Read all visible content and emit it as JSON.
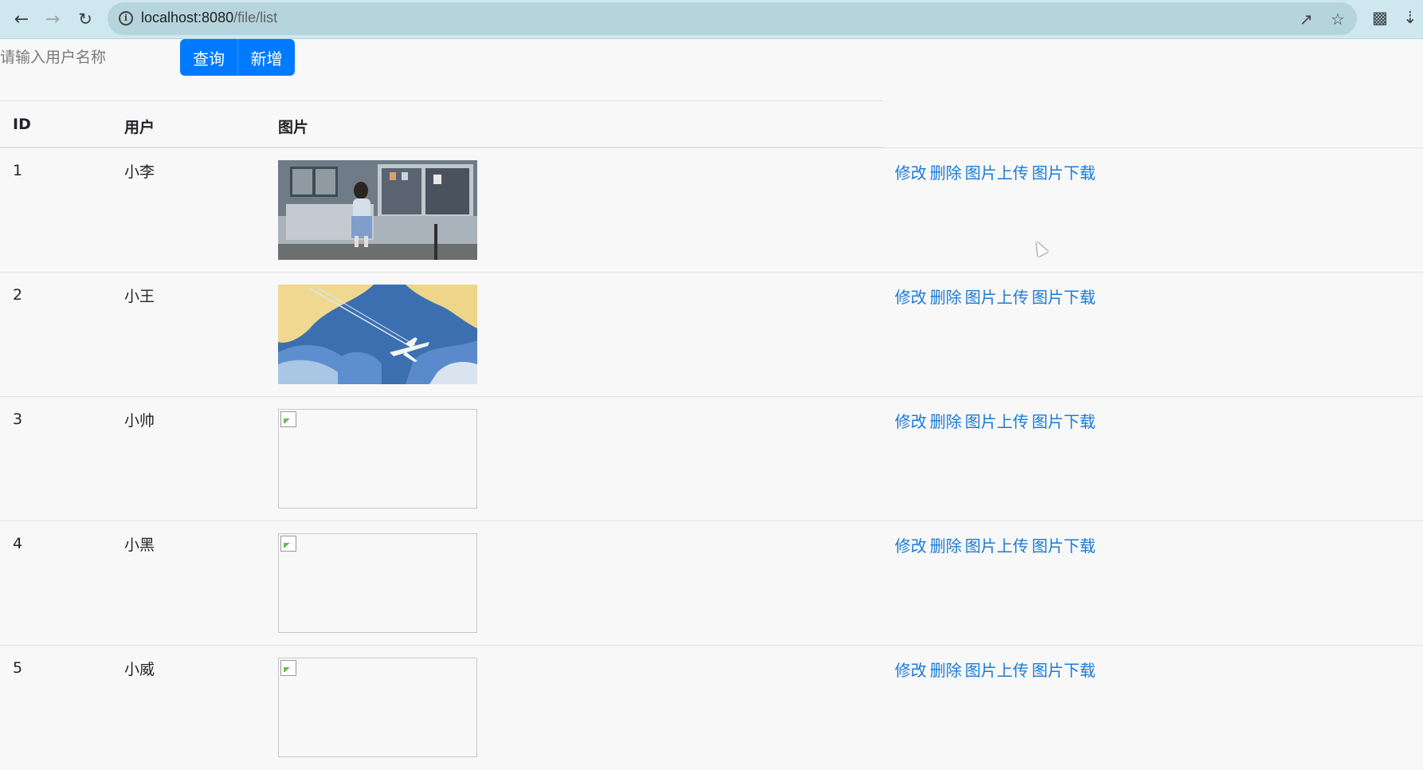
{
  "browser": {
    "url_host": "localhost:8080",
    "url_path": "/file/list",
    "back_icon": "arrow-left-icon",
    "forward_icon": "arrow-right-icon",
    "reload_icon": "reload-icon"
  },
  "toolbar": {
    "search_placeholder": "请输入用户名称",
    "query_label": "查询",
    "add_label": "新增"
  },
  "table": {
    "headers": {
      "id": "ID",
      "user": "用户",
      "image": "图片"
    },
    "rows": [
      {
        "id": "1",
        "user": "小李",
        "image": "photo-girl-sitting",
        "image_loaded": true
      },
      {
        "id": "2",
        "user": "小王",
        "image": "photo-airplane-clouds",
        "image_loaded": true
      },
      {
        "id": "3",
        "user": "小帅",
        "image": "broken-image",
        "image_loaded": false
      },
      {
        "id": "4",
        "user": "小黑",
        "image": "broken-image",
        "image_loaded": false
      },
      {
        "id": "5",
        "user": "小威",
        "image": "broken-image",
        "image_loaded": false
      }
    ],
    "actions": {
      "edit": "修改",
      "delete": "删除",
      "upload": "图片上传",
      "download": "图片下载"
    }
  },
  "colors": {
    "primary": "#007bff",
    "link": "#1a7bd7",
    "chrome_bg": "#cfe7ee",
    "omnibox_bg": "#b6d4db"
  }
}
